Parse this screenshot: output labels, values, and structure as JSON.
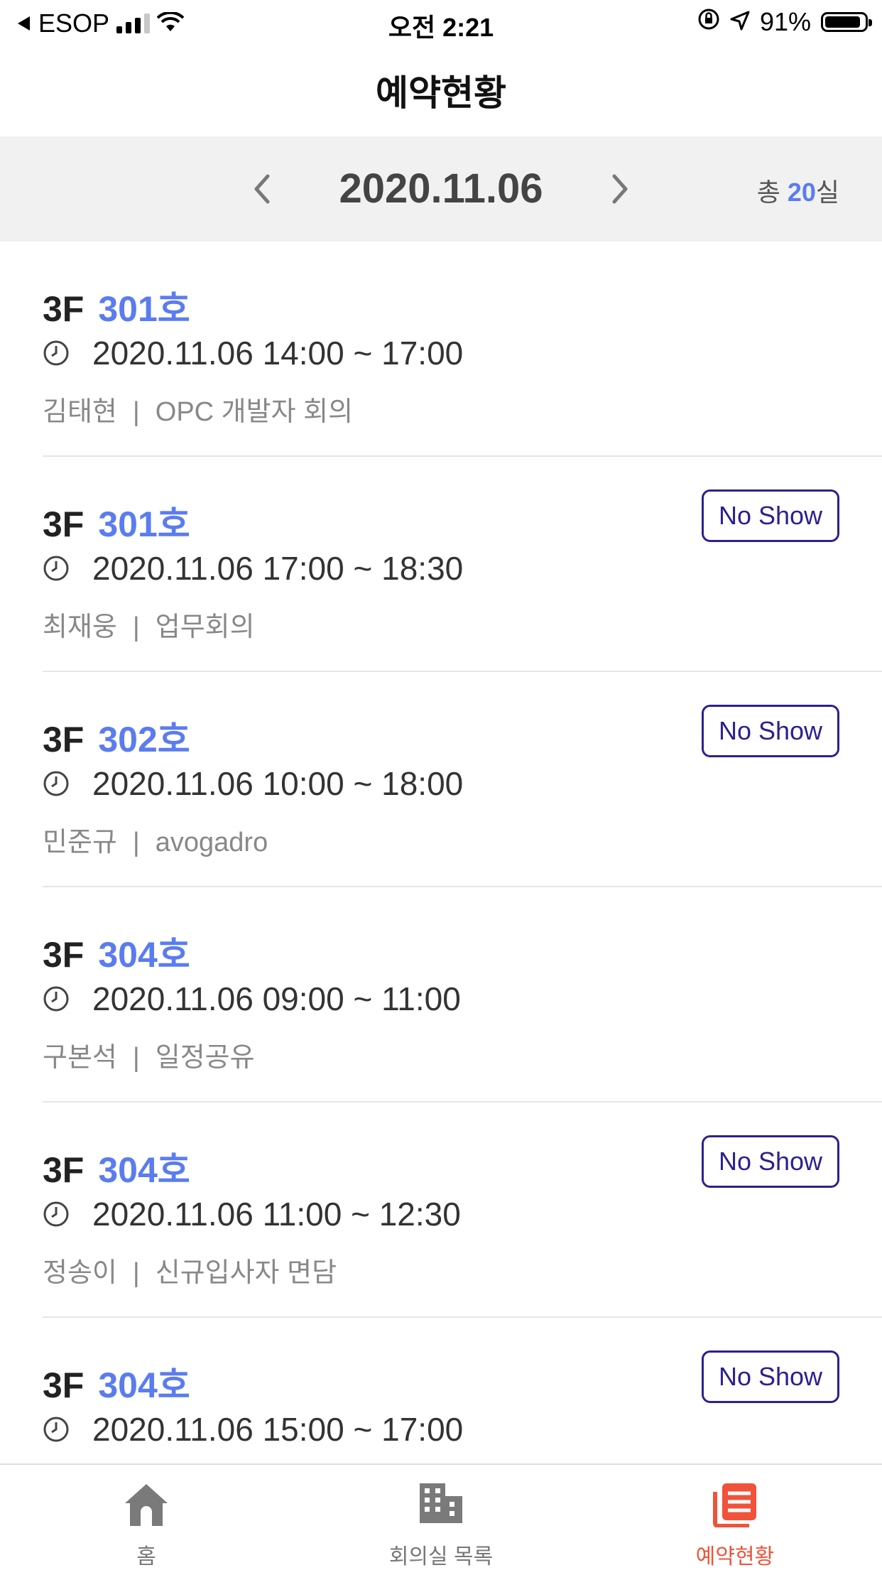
{
  "status_bar": {
    "carrier": "ESOP",
    "time": "오전 2:21",
    "battery": "91%",
    "battery_level": 0.91
  },
  "header": {
    "title": "예약현황"
  },
  "date_bar": {
    "date": "2020.11.06",
    "total_prefix": "총 ",
    "total_count": "20",
    "total_suffix": "실"
  },
  "reservations": [
    {
      "floor": "3F",
      "room": "301호",
      "time": "2020.11.06 14:00 ~ 17:00",
      "person": "김태현",
      "sep": "|",
      "title": "OPC 개발자 회의",
      "no_show": false
    },
    {
      "floor": "3F",
      "room": "301호",
      "time": "2020.11.06 17:00 ~ 18:30",
      "person": "최재웅",
      "sep": "|",
      "title": "업무회의",
      "no_show": true
    },
    {
      "floor": "3F",
      "room": "302호",
      "time": "2020.11.06 10:00 ~ 18:00",
      "person": "민준규",
      "sep": "|",
      "title": "avogadro",
      "no_show": true
    },
    {
      "floor": "3F",
      "room": "304호",
      "time": "2020.11.06 09:00 ~ 11:00",
      "person": "구본석",
      "sep": "|",
      "title": "일정공유",
      "no_show": false
    },
    {
      "floor": "3F",
      "room": "304호",
      "time": "2020.11.06 11:00 ~ 12:30",
      "person": "정송이",
      "sep": "|",
      "title": "신규입사자 면담",
      "no_show": true
    },
    {
      "floor": "3F",
      "room": "304호",
      "time": "2020.11.06 15:00 ~ 17:00",
      "person": "",
      "sep": "",
      "title": "",
      "no_show": true
    }
  ],
  "no_show_label": "No Show",
  "tabs": [
    {
      "label": "홈",
      "icon": "home-icon"
    },
    {
      "label": "회의실 목록",
      "icon": "building-icon"
    },
    {
      "label": "예약현황",
      "icon": "reservation-list-icon"
    }
  ],
  "colors": {
    "accent": "#5b7cf0",
    "active_tab": "#f0533a",
    "no_show_border": "#2b2190"
  }
}
